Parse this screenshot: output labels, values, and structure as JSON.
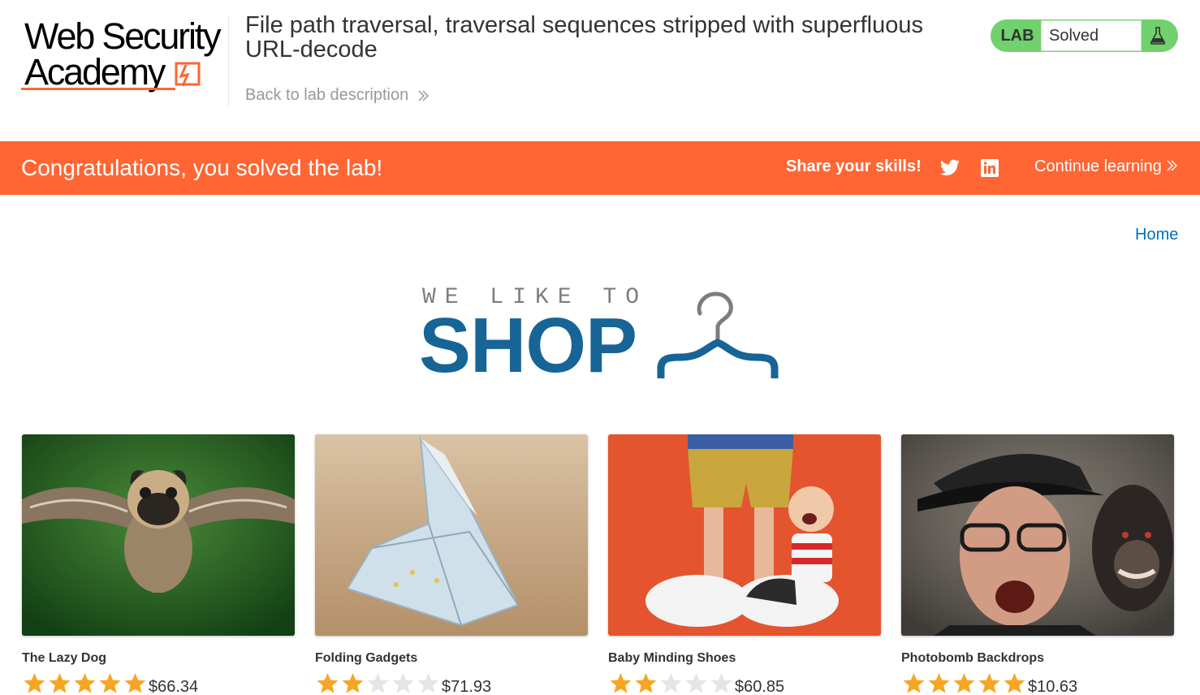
{
  "header": {
    "logo_line1": "Web Security",
    "logo_line2": "Academy",
    "lab_title": "File path traversal, traversal sequences stripped with superfluous URL-decode",
    "back_link": "Back to lab description",
    "lab_badge": "LAB",
    "lab_status": "Solved"
  },
  "banner": {
    "message": "Congratulations, you solved the lab!",
    "share": "Share your skills!",
    "continue": "Continue learning"
  },
  "nav": {
    "home": "Home"
  },
  "shop_banner": {
    "tagline": "WE LIKE TO",
    "word": "SHOP"
  },
  "products": [
    {
      "name": "The Lazy Dog",
      "rating": 5,
      "price": "$66.34",
      "image_icon": "flying-pug-photo"
    },
    {
      "name": "Folding Gadgets",
      "rating": 2,
      "price": "$71.93",
      "image_icon": "origami-banknote-photo"
    },
    {
      "name": "Baby Minding Shoes",
      "rating": 2,
      "price": "$60.85",
      "image_icon": "toy-figures-shoes-photo"
    },
    {
      "name": "Photobomb Backdrops",
      "rating": 5,
      "price": "$10.63",
      "image_icon": "man-and-monkey-photo"
    }
  ],
  "colors": {
    "accent": "#ff6633",
    "solved_green": "#70d16d",
    "link_blue": "#0071bc",
    "shop_blue": "#176496",
    "star_filled": "#f6a623",
    "star_empty": "#e5e5e5"
  }
}
